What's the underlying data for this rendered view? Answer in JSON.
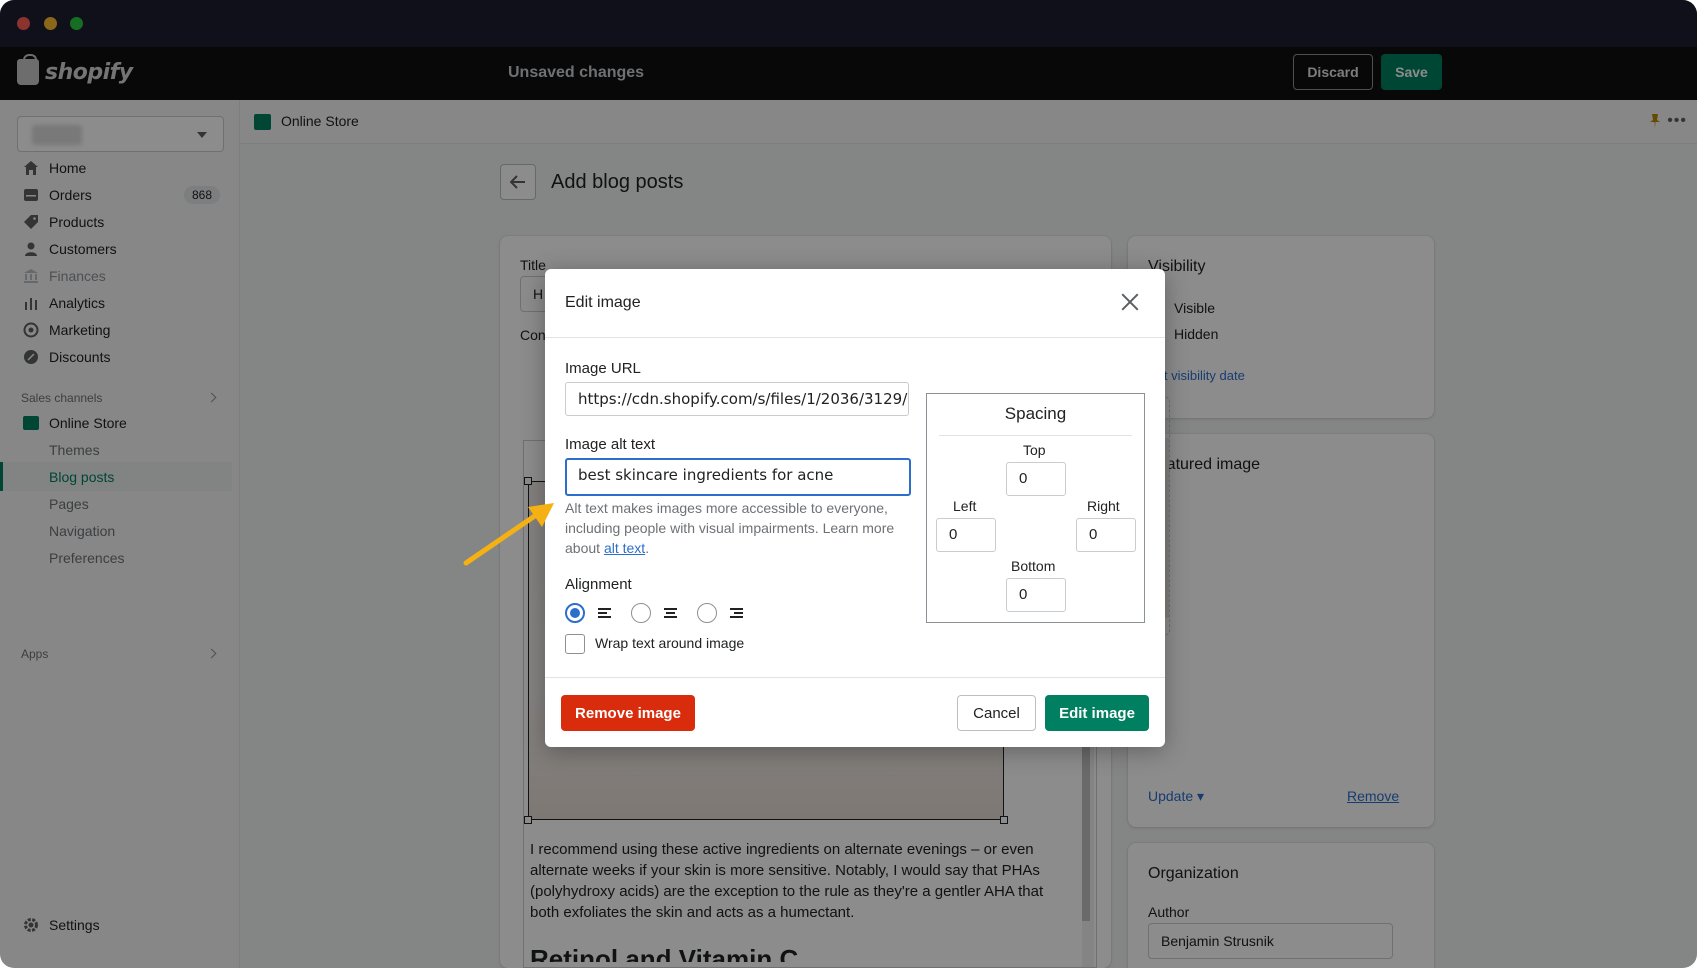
{
  "app": {
    "brand": "shopify",
    "status": "Unsaved changes",
    "discard_label": "Discard",
    "save_label": "Save"
  },
  "sidebar": {
    "items": [
      {
        "label": "Home",
        "icon": "home-icon"
      },
      {
        "label": "Orders",
        "icon": "orders-icon",
        "badge": "868"
      },
      {
        "label": "Products",
        "icon": "tag-icon"
      },
      {
        "label": "Customers",
        "icon": "person-icon"
      },
      {
        "label": "Finances",
        "icon": "bank-icon"
      },
      {
        "label": "Analytics",
        "icon": "bar-chart-icon"
      },
      {
        "label": "Marketing",
        "icon": "target-icon"
      },
      {
        "label": "Discounts",
        "icon": "discount-icon"
      }
    ],
    "sales_channels_label": "Sales channels",
    "online_store_label": "Online Store",
    "online_store_subitems": [
      "Themes",
      "Blog posts",
      "Pages",
      "Navigation",
      "Preferences"
    ],
    "active_subitem": "Blog posts",
    "apps_label": "Apps",
    "settings_label": "Settings"
  },
  "breadcrumb": {
    "label": "Online Store"
  },
  "page": {
    "title": "Add blog posts",
    "title_field_label": "Title",
    "title_value_partial": "H",
    "content_label_partial": "Con",
    "editor_paragraph": "I recommend using these active ingredients on alternate evenings – or even alternate weeks if your skin is more sensitive. Notably, I would say that PHAs (polyhydroxy acids) are the exception to the rule as they're a gentler AHA that both exfoliates the skin and acts as a humectant.",
    "editor_heading_partial": "Retinol and Vitamin C"
  },
  "visibility": {
    "title": "Visibility",
    "options": [
      "Visible",
      "Hidden"
    ],
    "date_link": "Set visibility date"
  },
  "featured_image": {
    "title": "Featured image",
    "update_label": "Update",
    "remove_label": "Remove"
  },
  "organization": {
    "title": "Organization",
    "author_label": "Author",
    "author_value": "Benjamin Strusnik"
  },
  "modal": {
    "title": "Edit image",
    "image_url_label": "Image URL",
    "image_url_value": "https://cdn.shopify.com/s/files/1/2036/3129/...",
    "alt_label": "Image alt text",
    "alt_value": "best skincare ingredients for acne",
    "help_text": "Alt text makes images more accessible to everyone, including people with visual impairments. Learn more about ",
    "help_link": "alt text",
    "help_end": ".",
    "alignment_label": "Alignment",
    "wrap_label": "Wrap text around image",
    "spacing": {
      "title": "Spacing",
      "top_label": "Top",
      "top_value": "0",
      "left_label": "Left",
      "left_value": "0",
      "right_label": "Right",
      "right_value": "0",
      "bottom_label": "Bottom",
      "bottom_value": "0"
    },
    "remove_label": "Remove image",
    "cancel_label": "Cancel",
    "edit_label": "Edit image"
  },
  "colors": {
    "primary_green": "#008060",
    "critical_red": "#d82c0d",
    "focus_blue": "#2c6ecb",
    "annotation_arrow": "#f5b014"
  }
}
